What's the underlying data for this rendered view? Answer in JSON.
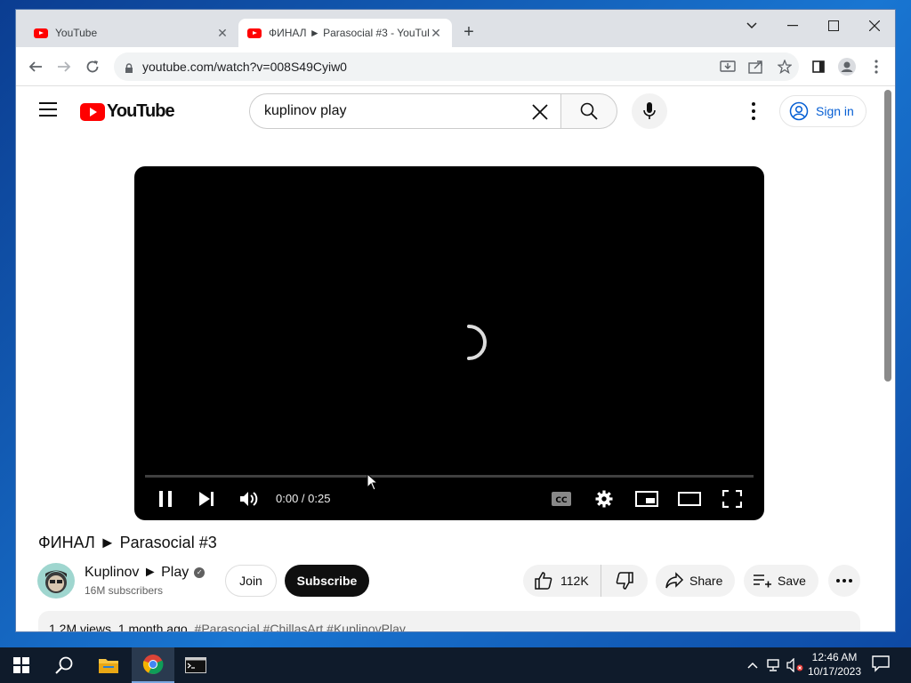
{
  "browser": {
    "tabs": [
      {
        "title": "YouTube",
        "active": false
      },
      {
        "title": "ФИНАЛ ► Parasocial #3 - YouTube",
        "active": true
      }
    ],
    "url": "youtube.com/watch?v=008S49Cyiw0"
  },
  "youtube": {
    "logo_text": "YouTube",
    "search_query": "kuplinov play",
    "signin_label": "Sign in",
    "player": {
      "time": "0:00 / 0:25",
      "progress_fraction": 0
    },
    "video_title": "ФИНАЛ ► Parasocial #3",
    "channel": {
      "name": "Kuplinov ► Play",
      "subscribers": "16M subscribers",
      "join_label": "Join",
      "subscribe_label": "Subscribe"
    },
    "actions": {
      "likes": "112K",
      "share_label": "Share",
      "save_label": "Save"
    },
    "description": {
      "views": "1.2M views",
      "age": "1 month ago",
      "tags": "#Parasocial #ChillasArt #KuplinovPlay"
    }
  },
  "taskbar": {
    "clock_time": "12:46 AM",
    "clock_date": "10/17/2023"
  },
  "colors": {
    "yt_red": "#ff0000",
    "link_blue": "#065fd4",
    "subscribe_bg": "#0f0f0f"
  }
}
